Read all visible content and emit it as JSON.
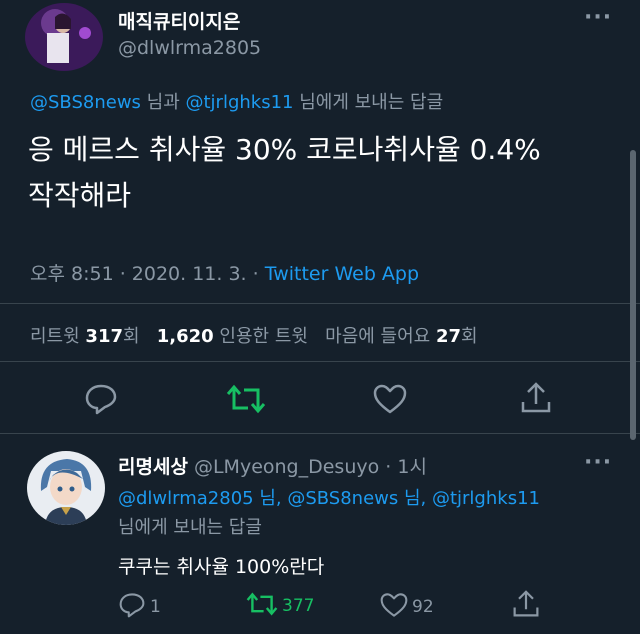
{
  "tweet": {
    "author_name": "매직큐티이지은",
    "author_handle": "@dlwlrma2805",
    "more_label": "···",
    "reply_to": {
      "user1": "@SBS8news",
      "joiner": " 님과 ",
      "user2": "@tjrlghks11",
      "suffix": " 님에게 보내는 답글"
    },
    "text_line1": "응 메르스 취사율 30% 코로나취사율 0.4%",
    "text_line2": "작작해라",
    "meta": {
      "time_date": "오후 8:51 · 2020. 11. 3. · ",
      "source": "Twitter Web App"
    },
    "stats": {
      "retweets_label": "리트윗",
      "retweets_count": "317",
      "retweets_unit": "회",
      "quotes_count": "1,620",
      "quotes_label": "인용한 트윗",
      "likes_label": "마음에 들어요",
      "likes_count": "27",
      "likes_unit": "회"
    },
    "actions": [
      "reply-icon",
      "retweet-icon",
      "like-icon",
      "share-icon"
    ]
  },
  "reply": {
    "author_name": "리명세상",
    "author_handle": "@LMyeong_Desuyo",
    "time": "· 1시",
    "more_label": "···",
    "reply_to_line1": "@dlwlrma2805 님, @SBS8news 님, @tjrlghks11",
    "reply_to_line2": "님에게 보내는 답글",
    "text": "쿠쿠는 취사율 100%란다",
    "reply_count": "1",
    "retweet_count": "377",
    "like_count": "92"
  },
  "colors": {
    "background": "#15202b",
    "muted": "#8b98a5",
    "link": "#1d9bf0",
    "retweet": "#17bf63",
    "divider": "#38444d"
  }
}
